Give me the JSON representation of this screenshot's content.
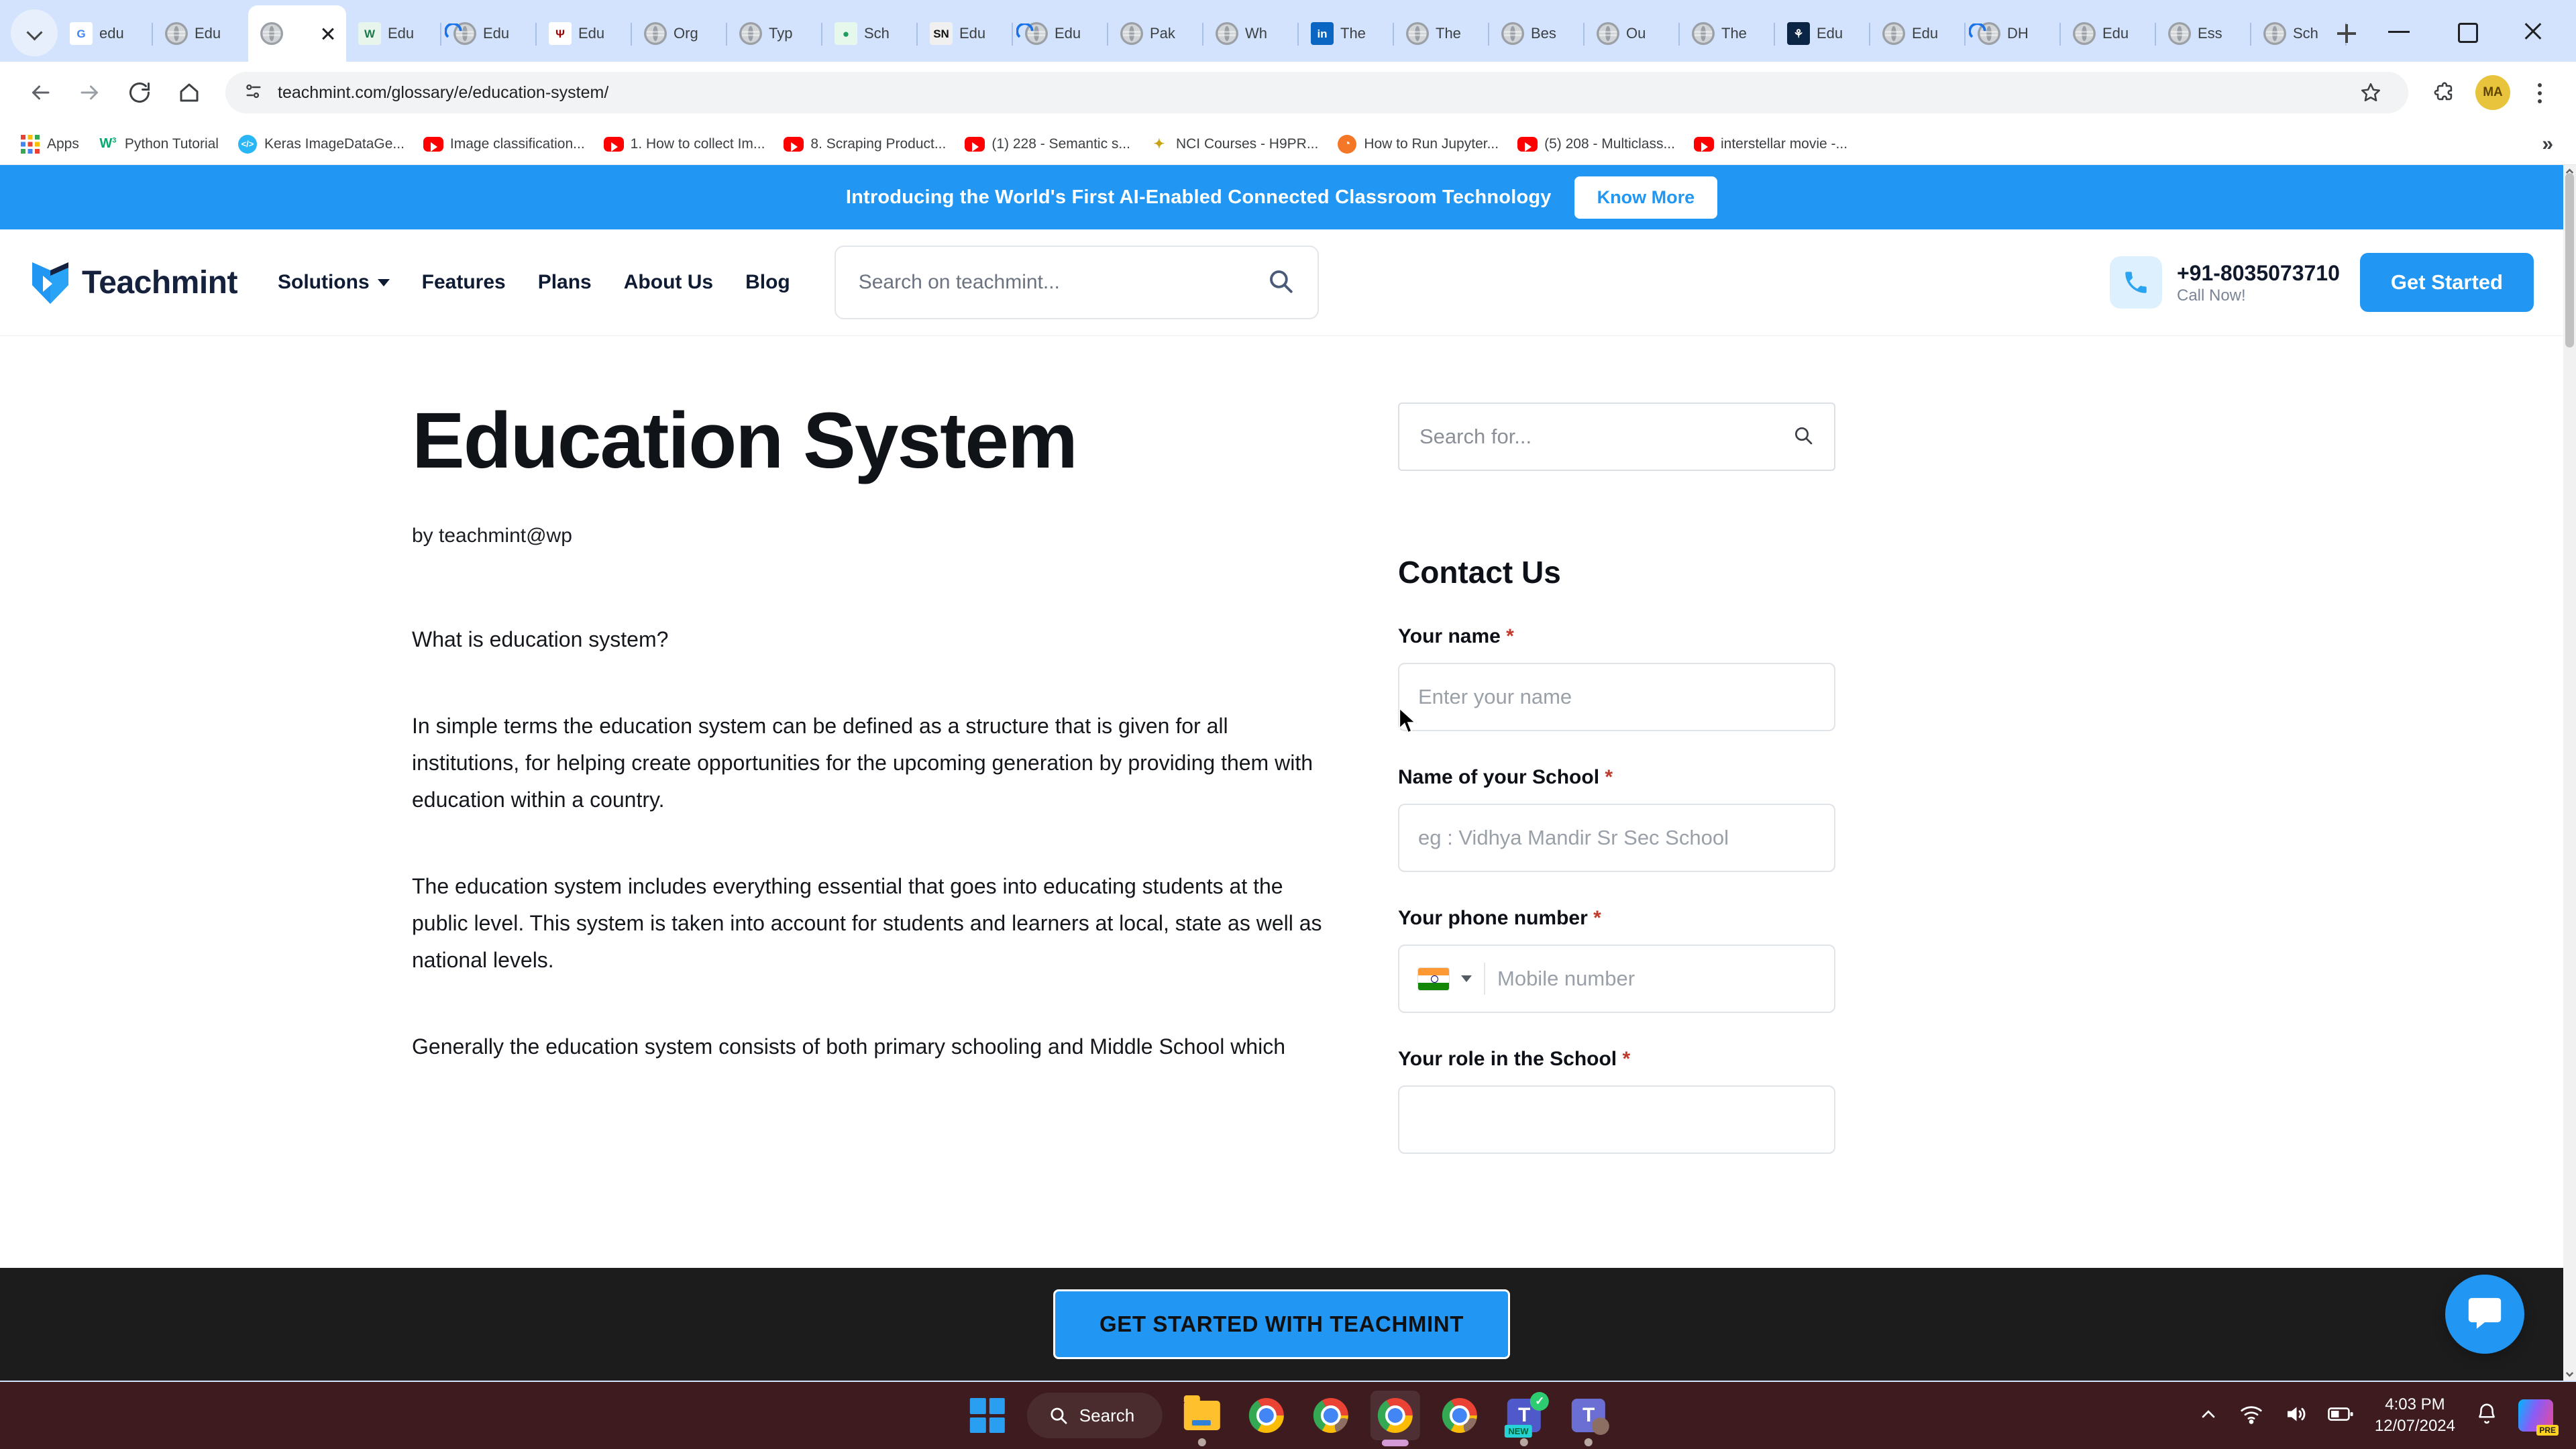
{
  "browser": {
    "tabs": [
      {
        "title": "edu",
        "icon": "google-icon",
        "active": false
      },
      {
        "title": "Edu",
        "icon": "globe-icon",
        "active": false
      },
      {
        "title": "",
        "icon": "globe-icon",
        "active": true
      },
      {
        "title": "Edu",
        "icon": "wes-icon",
        "active": false
      },
      {
        "title": "Edu",
        "icon": "globe-blue-icon",
        "active": false
      },
      {
        "title": "Edu",
        "icon": "iu-icon",
        "active": false
      },
      {
        "title": "Org",
        "icon": "globe-icon",
        "active": false
      },
      {
        "title": "Typ",
        "icon": "globe-icon",
        "active": false
      },
      {
        "title": "Sch",
        "icon": "green-icon",
        "active": false
      },
      {
        "title": "Edu",
        "icon": "sn-icon",
        "active": false
      },
      {
        "title": "Edu",
        "icon": "globe-blue-icon",
        "active": false
      },
      {
        "title": "Pak",
        "icon": "globe-icon",
        "active": false
      },
      {
        "title": "Wh",
        "icon": "globe-icon",
        "active": false
      },
      {
        "title": "The",
        "icon": "linkedin-icon",
        "active": false
      },
      {
        "title": "The",
        "icon": "globe-icon",
        "active": false
      },
      {
        "title": "Bes",
        "icon": "globe-icon",
        "active": false
      },
      {
        "title": "Ou",
        "icon": "globe-icon",
        "active": false
      },
      {
        "title": "The",
        "icon": "globe-icon",
        "active": false
      },
      {
        "title": "Edu",
        "icon": "navy-icon",
        "active": false
      },
      {
        "title": "Edu",
        "icon": "globe-icon",
        "active": false
      },
      {
        "title": "DH",
        "icon": "globe-blue-icon",
        "active": false
      },
      {
        "title": "Edu",
        "icon": "globe-icon",
        "active": false
      },
      {
        "title": "Ess",
        "icon": "globe-icon",
        "active": false
      },
      {
        "title": "Sch",
        "icon": "globe-icon",
        "active": false
      }
    ],
    "url": "teachmint.com/glossary/e/education-system/",
    "avatar_initials": "MA",
    "bookmarks": [
      {
        "label": "Apps",
        "icon": "apps-grid-icon"
      },
      {
        "label": "Python Tutorial",
        "icon": "w3schools-icon"
      },
      {
        "label": "Keras ImageDataGe...",
        "icon": "doc-icon"
      },
      {
        "label": "Image classification...",
        "icon": "youtube-icon"
      },
      {
        "label": "1. How to collect Im...",
        "icon": "youtube-icon"
      },
      {
        "label": "8. Scraping Product...",
        "icon": "youtube-icon"
      },
      {
        "label": "(1) 228 - Semantic s...",
        "icon": "youtube-icon"
      },
      {
        "label": "NCI Courses - H9PR...",
        "icon": "nci-icon"
      },
      {
        "label": "How to Run Jupyter...",
        "icon": "orange-icon"
      },
      {
        "label": "(5) 208 - Multiclass...",
        "icon": "youtube-icon"
      },
      {
        "label": "interstellar movie -...",
        "icon": "youtube-icon"
      }
    ],
    "bookmarks_overflow": "»"
  },
  "promo": {
    "text": "Introducing the World's First AI-Enabled Connected Classroom Technology",
    "button": "Know More"
  },
  "site_header": {
    "logo_text": "Teachmint",
    "nav": [
      {
        "label": "Solutions",
        "has_caret": true
      },
      {
        "label": "Features",
        "has_caret": false
      },
      {
        "label": "Plans",
        "has_caret": false
      },
      {
        "label": "About Us",
        "has_caret": false
      },
      {
        "label": "Blog",
        "has_caret": false
      }
    ],
    "search_placeholder": "Search on teachmint...",
    "phone_number": "+91-8035073710",
    "phone_sub": "Call Now!",
    "cta_label": "Get Started"
  },
  "article": {
    "title": "Education System",
    "byline": "by teachmint@wp",
    "paragraphs": [
      "What is education system?",
      "In simple terms the education system can be defined as a structure that is given for all institutions, for helping create opportunities for the upcoming generation by providing them with education within a country.",
      "The education system includes everything essential that goes into educating students at the public level. This system is taken into account for students and learners at local, state as well as national levels.",
      "Generally the education system consists of both primary schooling and Middle School which"
    ]
  },
  "sidebar": {
    "search_placeholder": "Search for...",
    "contact_title": "Contact Us",
    "fields": [
      {
        "label": "Your name",
        "required": "*",
        "placeholder": "Enter your name",
        "type": "text"
      },
      {
        "label": "Name of your School",
        "required": "*",
        "placeholder": "eg : Vidhya Mandir Sr Sec School",
        "type": "text"
      },
      {
        "label": "Your phone number",
        "required": "*",
        "placeholder": "Mobile number",
        "type": "phone"
      },
      {
        "label": "Your role in the School",
        "required": "*",
        "placeholder": "",
        "type": "select"
      }
    ]
  },
  "sticky": {
    "button": "GET STARTED WITH TEACHMINT"
  },
  "taskbar": {
    "search_label": "Search",
    "time": "4:03 PM",
    "date": "12/07/2024"
  },
  "colors": {
    "accent": "#2196f3",
    "chrome_tabstrip": "#d3e3fd",
    "taskbar": "#3d1b1f",
    "required": "#c0392b"
  }
}
